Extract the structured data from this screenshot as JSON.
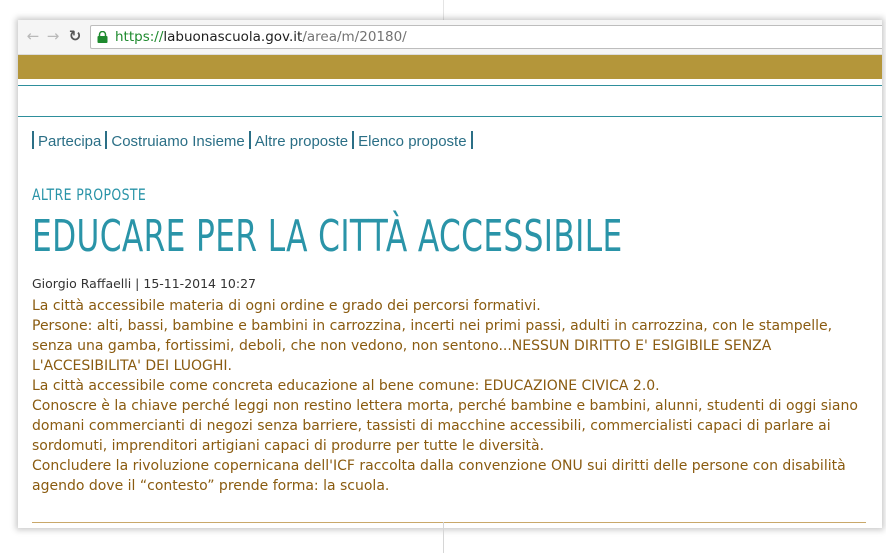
{
  "browser": {
    "back_icon": "arrow-left-icon",
    "forward_icon": "arrow-right-icon",
    "reload_icon": "reload-icon",
    "lock_icon": "lock-icon",
    "url_scheme": "https://",
    "url_host": "labuonascuola.gov.it",
    "url_path": "/area/m/20180/"
  },
  "colors": {
    "gold_band": "#b4963a",
    "teal": "#2a94a8",
    "body_text": "#8a5b10",
    "nav_link": "#2b6f86"
  },
  "subnav": {
    "items": [
      {
        "label": "Partecipa"
      },
      {
        "label": "Costruiamo Insieme"
      },
      {
        "label": "Altre proposte"
      },
      {
        "label": "Elenco proposte"
      }
    ]
  },
  "article": {
    "section": "ALTRE PROPOSTE",
    "title": "EDUCARE PER LA CITTÀ ACCESSIBILE",
    "byline": "Giorgio Raffaelli | 15-11-2014 10:27",
    "paragraphs": [
      "La città accessibile materia di ogni ordine e grado dei percorsi formativi.",
      "Persone: alti, bassi, bambine e bambini in carrozzina, incerti nei primi passi, adulti in carrozzina, con le stampelle, senza una gamba, fortissimi, deboli, che non vedono, non sentono...NESSUN DIRITTO E' ESIGIBILE SENZA L'ACCESIBILITA' DEI LUOGHI.",
      "La città accessibile come concreta educazione al bene comune: EDUCAZIONE CIVICA 2.0.",
      "Conoscre è la chiave perché leggi non restino lettera morta, perché bambine e bambini, alunni, studenti di oggi siano domani commercianti di negozi senza barriere, tassisti di macchine accessibili, commercialisti capaci di parlare ai sordomuti, imprenditori artigiani capaci di produrre per tutte le diversità.",
      "Concludere la rivoluzione copernicana dell'ICF raccolta dalla convenzione ONU sui diritti delle persone con disabilità agendo dove il “contesto” prende forma: la scuola."
    ]
  }
}
